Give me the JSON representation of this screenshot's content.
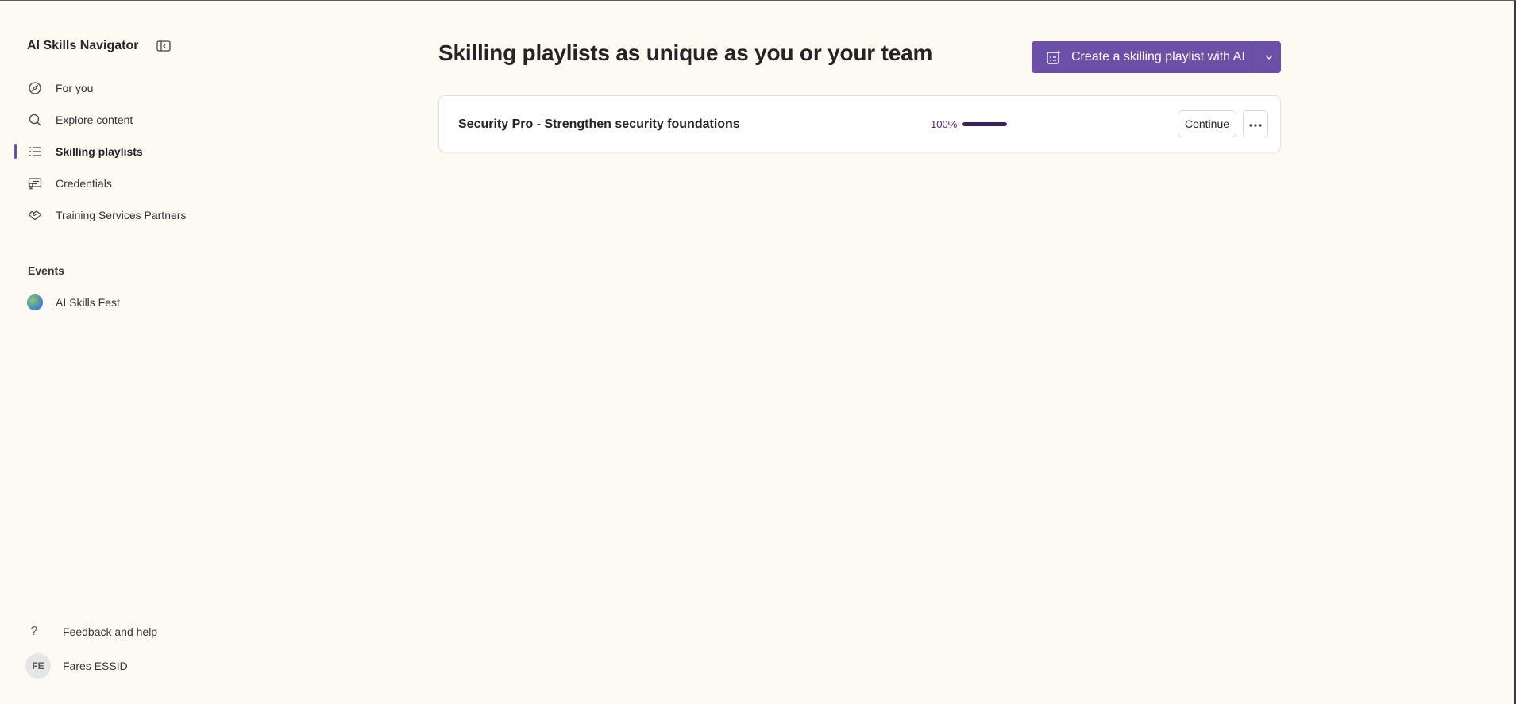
{
  "sidebar": {
    "brand": "AI Skills Navigator",
    "nav_items": [
      {
        "label": "For you",
        "icon": "compass-icon"
      },
      {
        "label": "Explore content",
        "icon": "search-icon"
      },
      {
        "label": "Skilling playlists",
        "icon": "list-icon",
        "active": true
      },
      {
        "label": "Credentials",
        "icon": "certificate-icon"
      },
      {
        "label": "Training Services Partners",
        "icon": "handshake-icon"
      }
    ],
    "events_heading": "Events",
    "events": [
      {
        "label": "AI Skills Fest",
        "icon": "event-avatar"
      }
    ],
    "footer": {
      "help_icon": "?",
      "help_label": "Feedback and help",
      "user_initials": "FE",
      "user_name": "Fares ESSID"
    }
  },
  "main": {
    "title": "Skilling playlists as unique as you or your team",
    "create_button_label": "Create a skilling playlist with AI",
    "playlists": [
      {
        "title": "Security Pro - Strengthen security foundations",
        "progress_text": "100%",
        "progress": 1.0,
        "continue_label": "Continue"
      }
    ]
  },
  "colors": {
    "background": "#fdfaf3",
    "accent": "#6b4fa8",
    "progress_fill": "#3b1f5e"
  }
}
